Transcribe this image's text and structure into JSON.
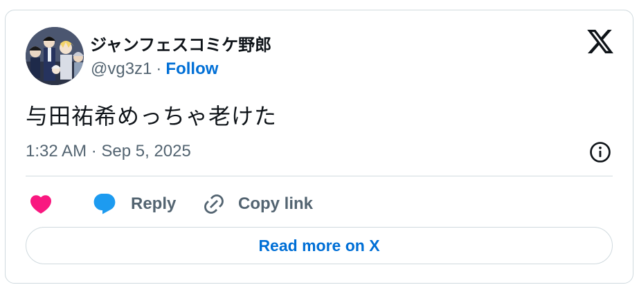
{
  "author": {
    "display_name": "ジャンフェスコミケ野郎",
    "handle": "@vg3z1",
    "separator": "·",
    "follow_label": "Follow",
    "avatar_icon": "anime-characters-avatar"
  },
  "brand_icon": "x-logo-icon",
  "tweet": {
    "text": "与田祐希めっちゃ老けた",
    "timestamp": "1:32 AM · Sep 5, 2025"
  },
  "actions": {
    "like_icon": "heart-icon",
    "reply_label": "Reply",
    "reply_icon": "speech-bubble-icon",
    "copy_label": "Copy link",
    "copy_icon": "link-icon"
  },
  "read_more_label": "Read more on X",
  "colors": {
    "like": "#f91880",
    "reply_bubble": "#1d9bf0",
    "link": "#006fd6",
    "muted": "#536471",
    "border": "#cfd9de",
    "text": "#0f1419"
  }
}
